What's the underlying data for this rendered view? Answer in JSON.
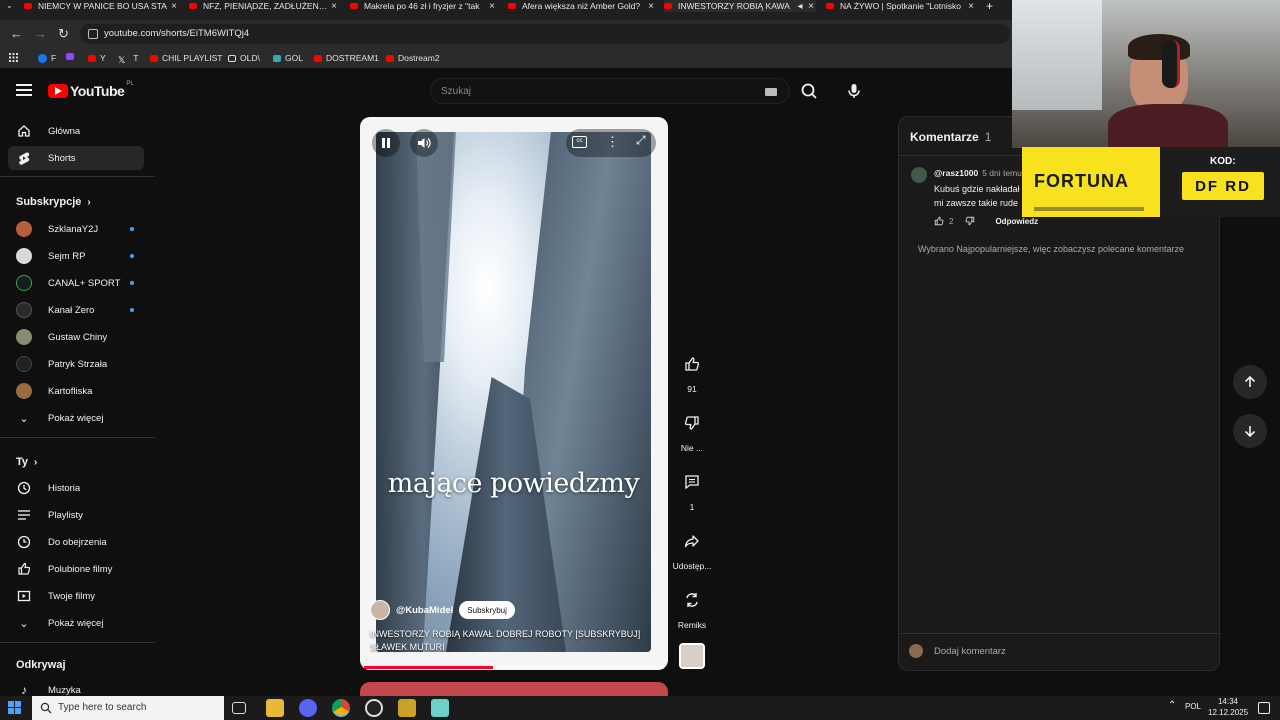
{
  "browser": {
    "tabs": [
      {
        "title": "NIEMCY W PANICE BO USA STA",
        "active": false
      },
      {
        "title": "NFZ, PIENIĄDZE, ZADŁUŻENIE S",
        "active": false
      },
      {
        "title": "Makrela po 46 zł i fryzjer z \"tak",
        "active": false
      },
      {
        "title": "Afera większa niż Amber Gold?",
        "active": false
      },
      {
        "title": "INWESTORZY ROBIĄ KAWA",
        "active": true
      },
      {
        "title": "NA ŻYWO | Spotkanie \"Lotnisko",
        "active": false
      }
    ],
    "url": "youtube.com/shorts/EiTM6WITQj4",
    "bookmarks": [
      "F",
      "Y",
      "T",
      "CHIL PLAYLIST",
      "OLD\\",
      "GOL",
      "DOSTREAM1",
      "Dostream2"
    ]
  },
  "masthead": {
    "logo_text": "YouTube",
    "country_code": "PL",
    "search_placeholder": "Szukaj"
  },
  "guide": {
    "main": [
      {
        "label": "Główna",
        "icon": "home-icon"
      },
      {
        "label": "Shorts",
        "icon": "shorts-icon",
        "selected": true
      }
    ],
    "subscriptions_header": "Subskrypcje",
    "subscriptions": [
      {
        "label": "SzklanaY2J",
        "avatar_color": "#b85c3a",
        "live_dot": true
      },
      {
        "label": "Sejm RP",
        "avatar_color": "#d9d9d9",
        "live_dot": true
      },
      {
        "label": "CANAL+ SPORT",
        "avatar_color": "#1a1a1a",
        "live_dot": true
      },
      {
        "label": "Kanał Zero",
        "avatar_color": "#2a2a2a",
        "live_dot": true
      },
      {
        "label": "Gustaw Chiny",
        "avatar_color": "#8a8a70",
        "live_dot": false
      },
      {
        "label": "Patryk Strzała",
        "avatar_color": "#222222",
        "live_dot": false
      },
      {
        "label": "Kartofliska",
        "avatar_color": "#9a6a40",
        "live_dot": false
      }
    ],
    "show_more": "Pokaż więcej",
    "you_header": "Ty",
    "you": [
      {
        "label": "Historia",
        "icon": "history-icon"
      },
      {
        "label": "Playlisty",
        "icon": "playlists-icon"
      },
      {
        "label": "Do obejrzenia",
        "icon": "watch-later-icon"
      },
      {
        "label": "Polubione filmy",
        "icon": "liked-icon"
      },
      {
        "label": "Twoje filmy",
        "icon": "your-videos-icon"
      }
    ],
    "show_more_2": "Pokaż więcej",
    "explore_header": "Odkrywaj",
    "explore": [
      {
        "label": "Muzyka",
        "icon": "music-icon"
      }
    ]
  },
  "short": {
    "overlay_text": "mające powiedzmy",
    "channel": "@KubaMidel",
    "subscribe_label": "Subskrybuj",
    "title": "INWESTORZY ROBIĄ KAWAŁ DOBREJ ROBOTY [SUBSKRYBUJ] SŁAWEK MUTURI",
    "progress": 0.43
  },
  "actions": {
    "like_count": "91",
    "dislike_label": "Nie ...",
    "comments_count": "1",
    "share_label": "Udostęp...",
    "remix_label": "Remiks"
  },
  "comments": {
    "title": "Komentarze",
    "count": "1",
    "items": [
      {
        "author": "@rasz1000",
        "ago": "5 dni temu",
        "text_line1": "Kubuś gdzie nakładał",
        "text_line2": "mi zawsze takie rude",
        "likes": "2",
        "reply_label": "Odpowiedz"
      }
    ],
    "note": "Wybrano Najpopularniejsze, więc zobaczysz polecane komentarze",
    "add_placeholder": "Dodaj komentarz"
  },
  "ad": {
    "brand": "FORTUNA",
    "code_label": "KOD:",
    "code": "DF RD"
  },
  "taskbar": {
    "search_placeholder": "Type here to search",
    "lang": "POL",
    "time": "14:34",
    "date": "12.12.2025"
  },
  "colors": {
    "yt_red": "#ff0000",
    "accent_blue": "#3ea6ff",
    "fortuna_yellow": "#f7e21d",
    "progress_red": "#ff0033"
  }
}
